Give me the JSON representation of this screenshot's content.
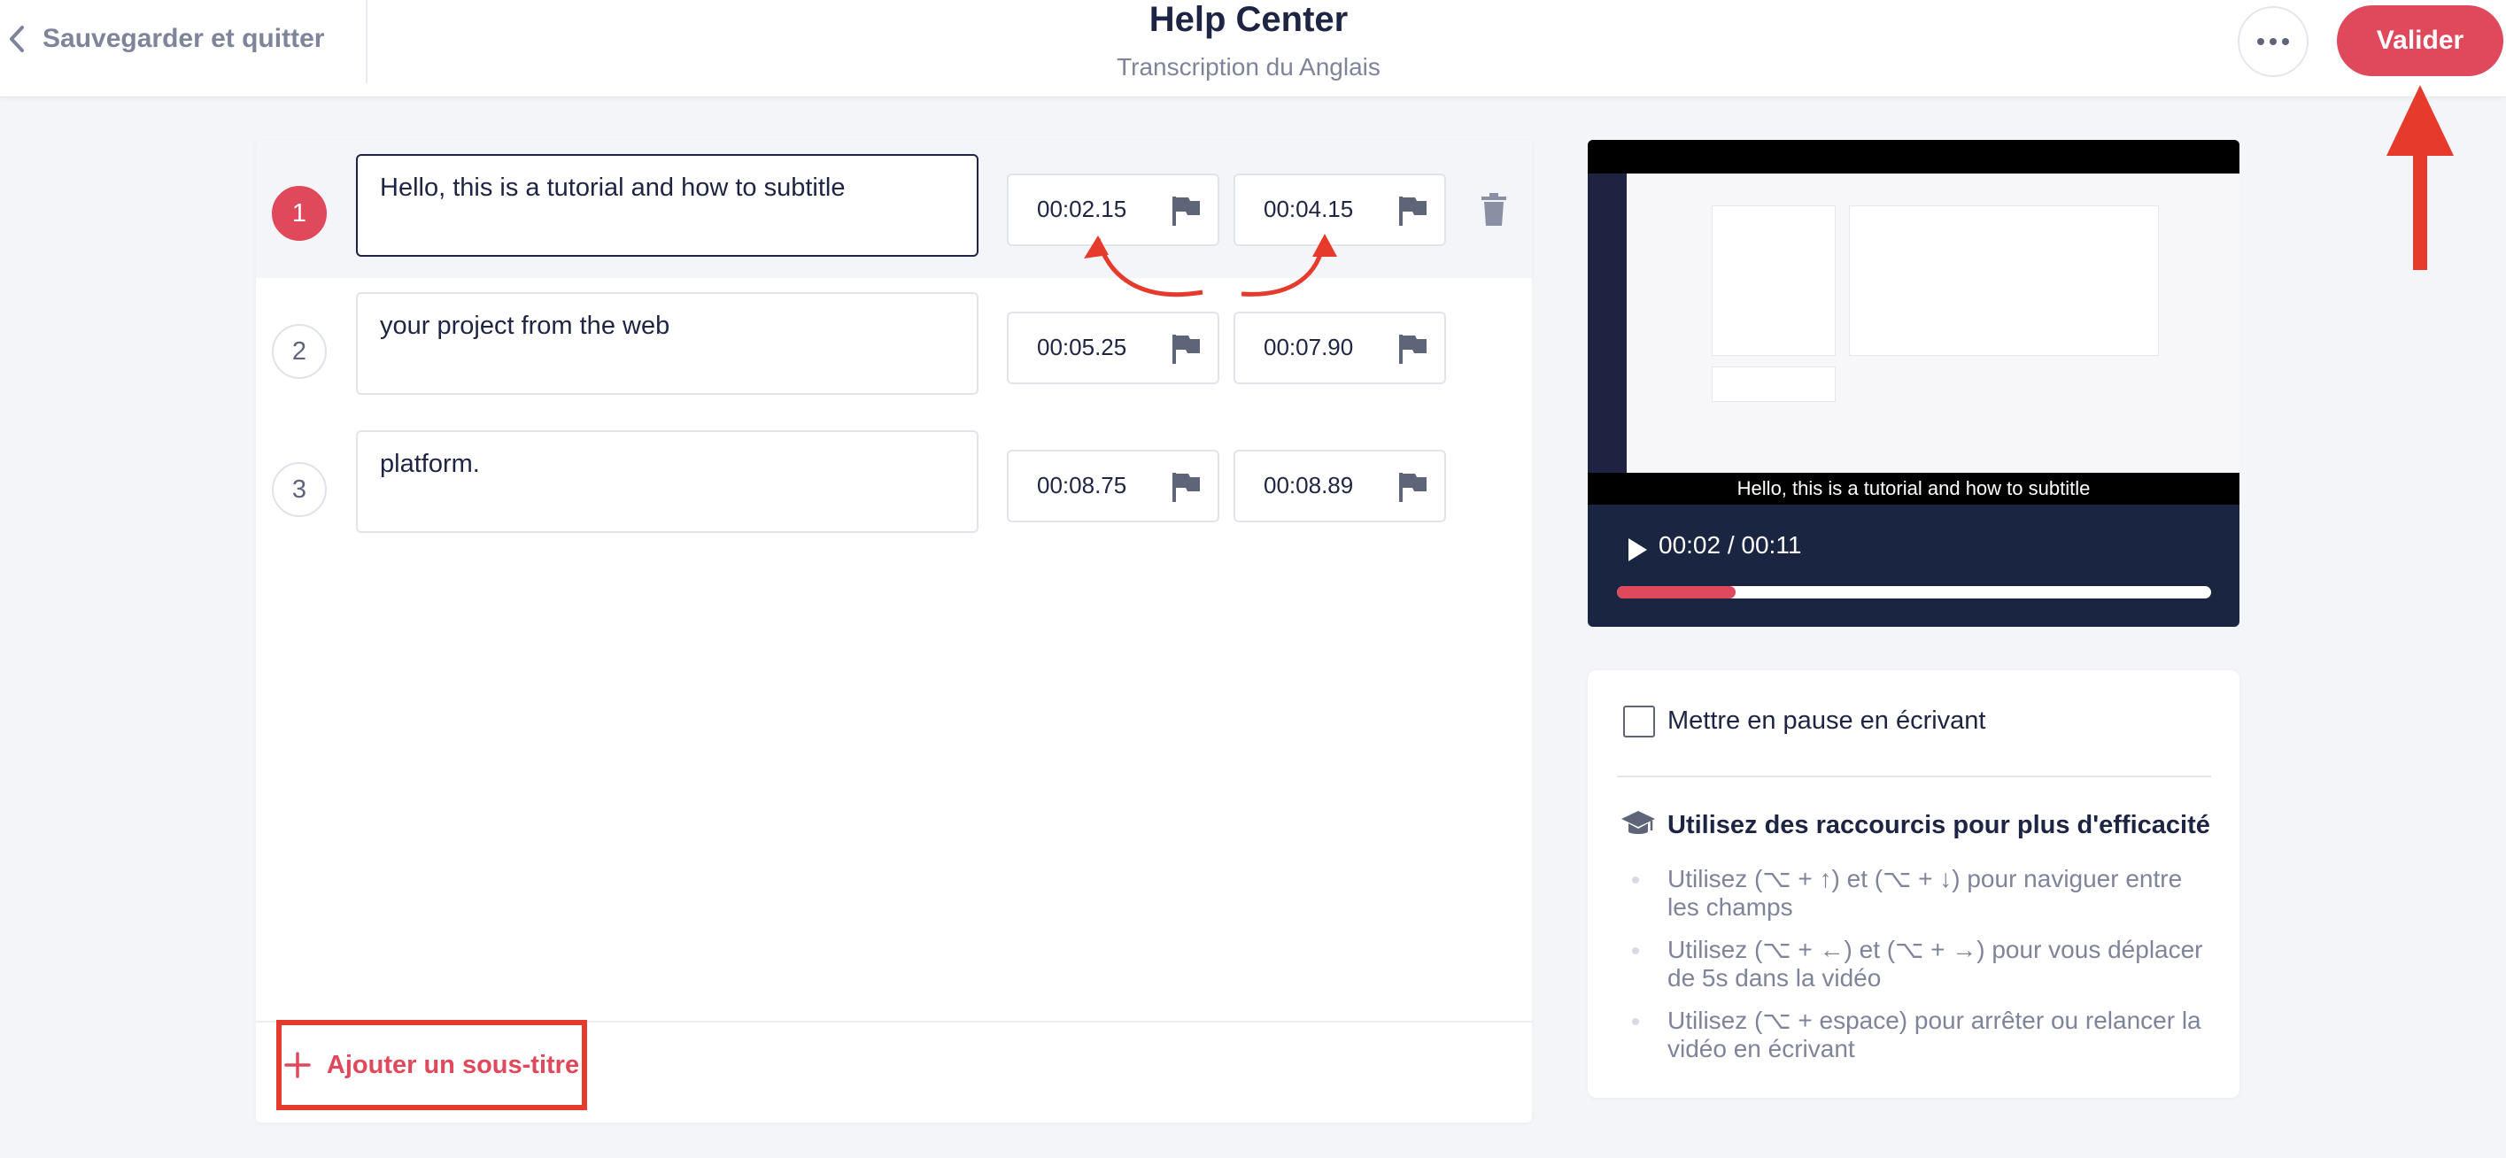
{
  "header": {
    "back_label": "Sauvegarder et quitter",
    "title": "Help Center",
    "subtitle": "Transcription du Anglais",
    "more_label": "…",
    "validate_label": "Valider"
  },
  "subtitles": [
    {
      "index": "1",
      "text": "Hello, this is a tutorial and how to subtitle",
      "start": "00:02.15",
      "end": "00:04.15",
      "active": true
    },
    {
      "index": "2",
      "text": "your project from the web",
      "start": "00:05.25",
      "end": "00:07.90",
      "active": false
    },
    {
      "index": "3",
      "text": "platform.",
      "start": "00:08.75",
      "end": "00:08.89",
      "active": false
    }
  ],
  "add_subtitle_label": "Ajouter un sous-titre",
  "video": {
    "caption": "Hello, this is a tutorial and how to subtitle",
    "time_display": "00:02 / 00:11",
    "progress": 0.2
  },
  "settings": {
    "pause_label": "Mettre en pause en écrivant",
    "pause_checked": false,
    "shortcuts_title": "Utilisez des raccourcis pour plus d'efficacité",
    "shortcuts": [
      "Utilisez (⌥ + ↑) et (⌥ + ↓) pour naviguer entre les champs",
      "Utilisez (⌥ + ←) et (⌥ + →) pour vous déplacer de 5s dans la vidéo",
      "Utilisez (⌥ + espace) pour arrêter ou relancer la vidéo en écrivant"
    ]
  },
  "colors": {
    "accent": "#e0485b",
    "annotation": "#e63a2c",
    "text": "#1e2443",
    "muted": "#7e8499",
    "player_bg": "#1a2541"
  }
}
